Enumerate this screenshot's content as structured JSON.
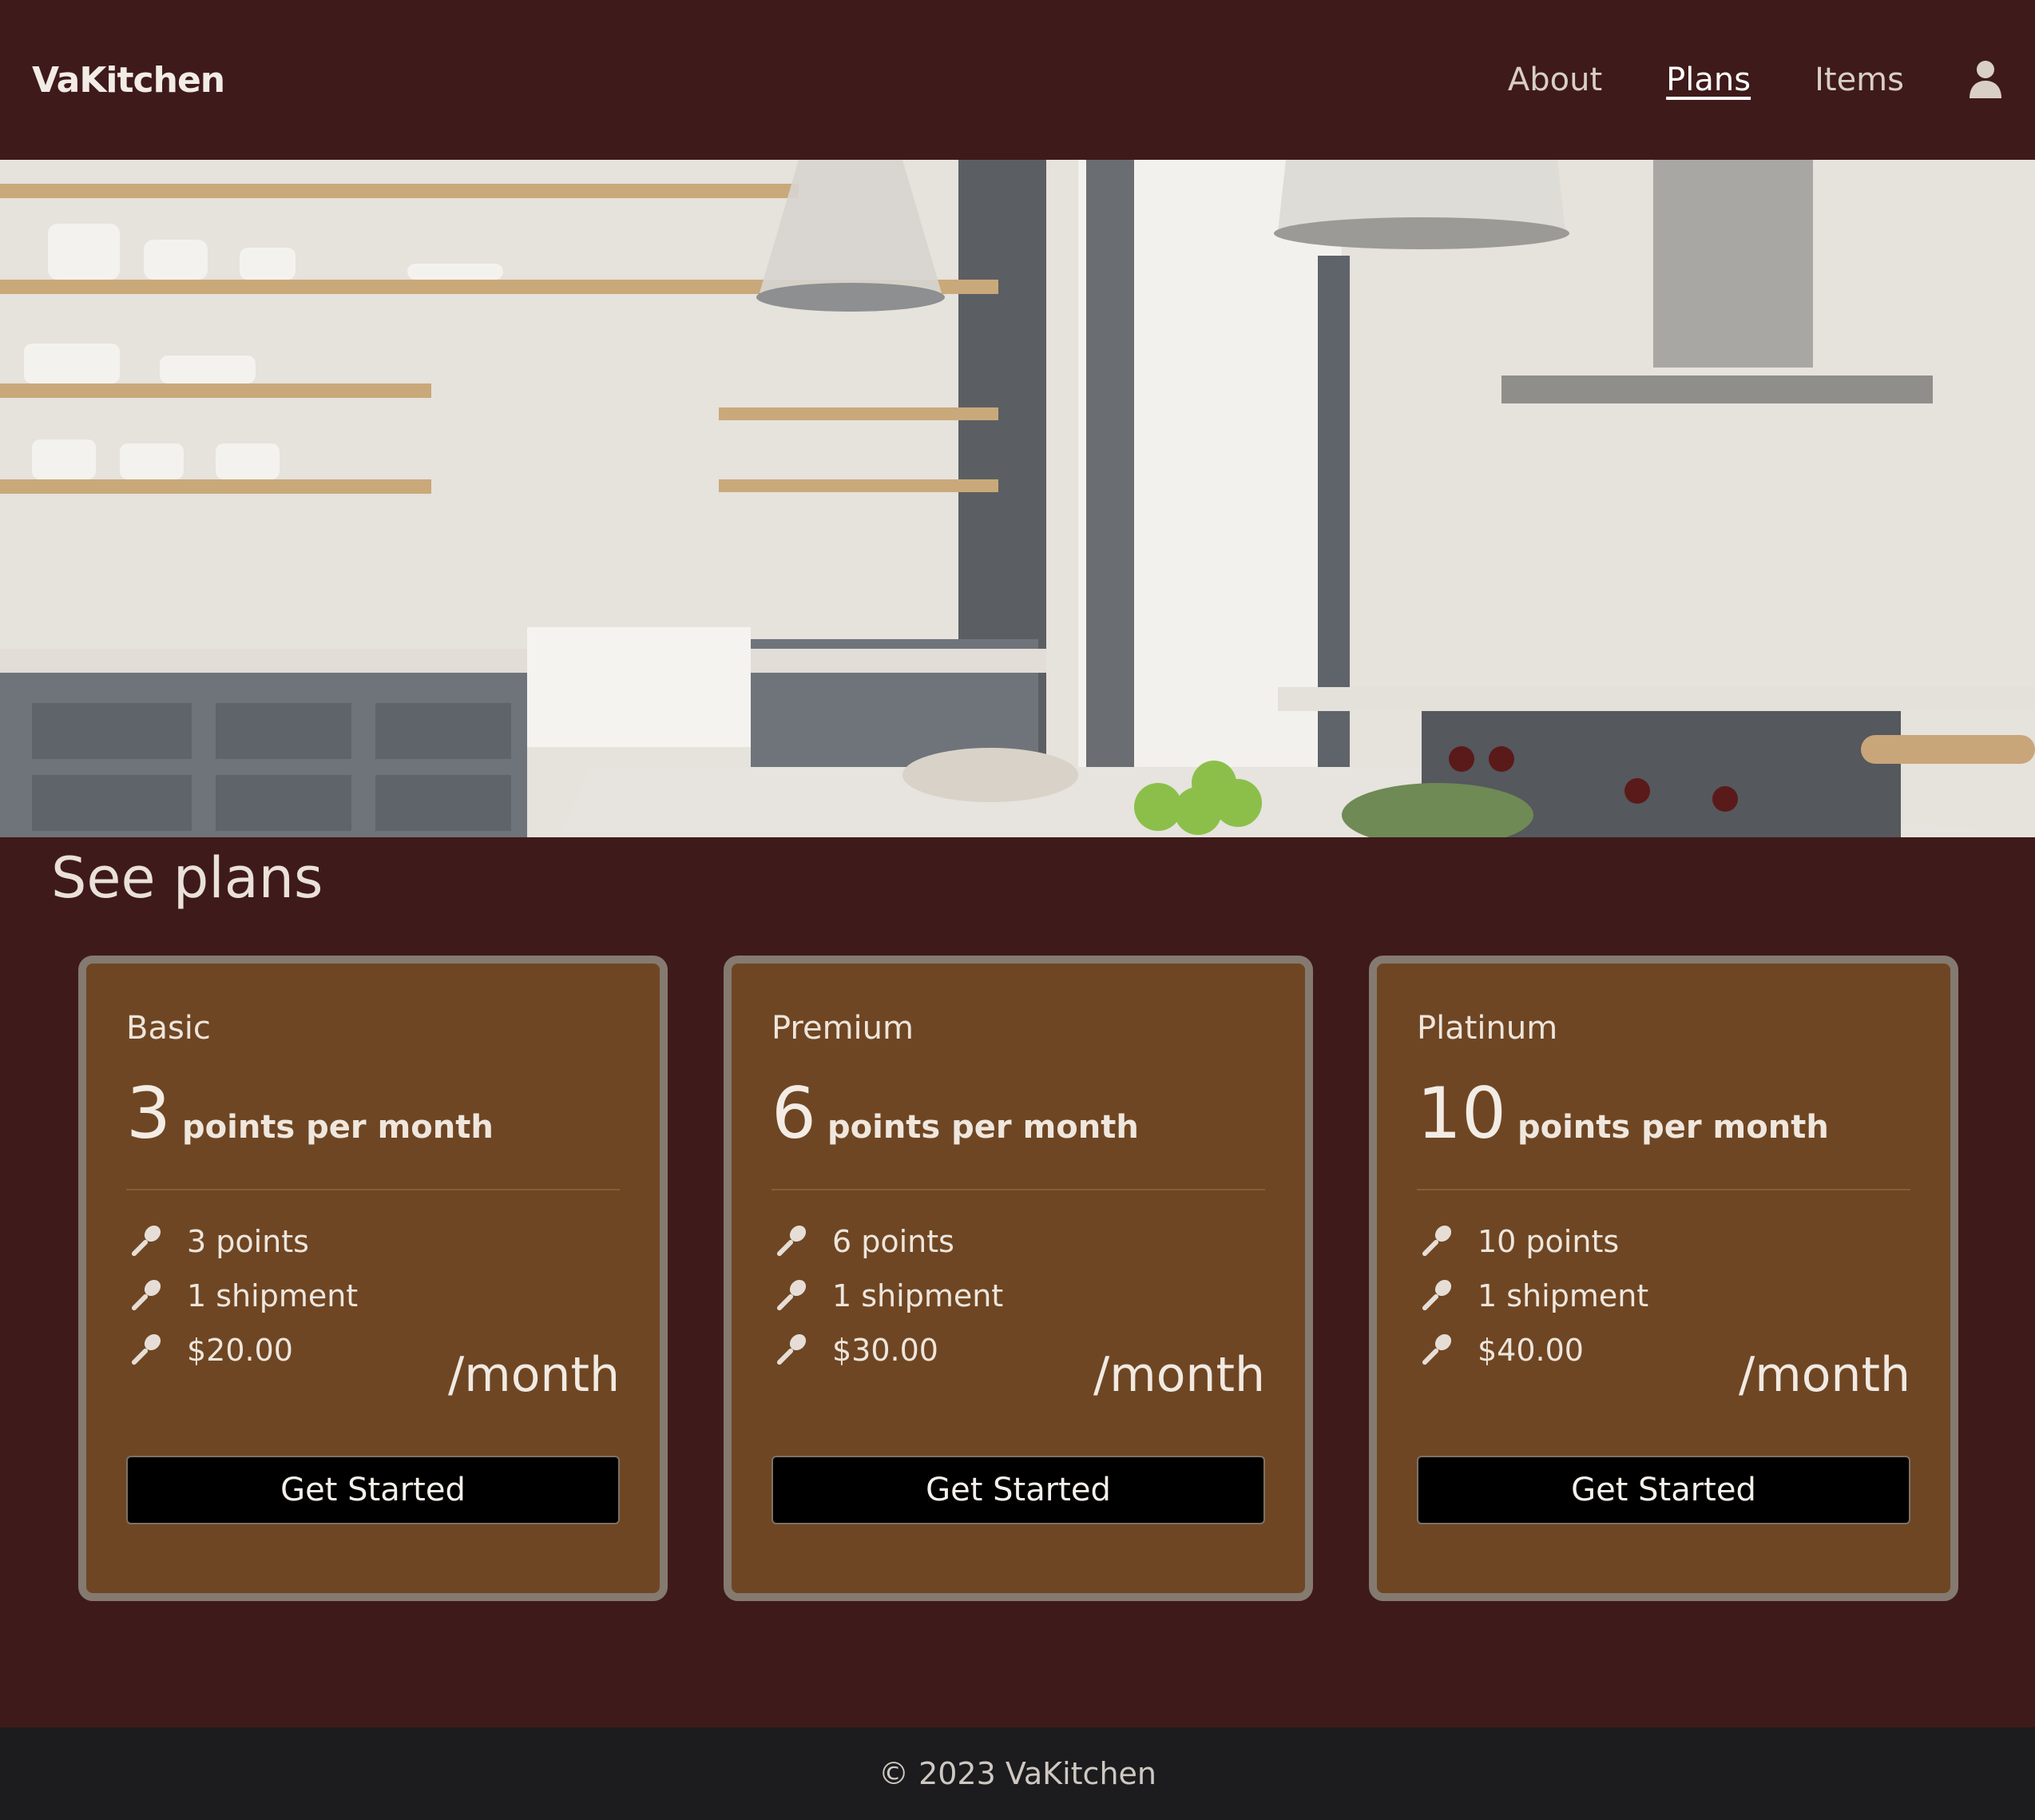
{
  "nav": {
    "brand": "VaKitchen",
    "links": [
      {
        "label": "About"
      },
      {
        "label": "Plans"
      },
      {
        "label": "Items"
      }
    ],
    "user_icon": "user-icon"
  },
  "hero": {
    "image": "kitchen-photo"
  },
  "section": {
    "title": "See plans"
  },
  "plans": [
    {
      "name": "Basic",
      "points": "3",
      "points_unit": "points per month",
      "features": [
        "3 points",
        "1 shipment",
        "$20.00"
      ],
      "per_month": "/month",
      "cta": "Get Started"
    },
    {
      "name": "Premium",
      "points": "6",
      "points_unit": "points per month",
      "features": [
        "6 points",
        "1 shipment",
        "$30.00"
      ],
      "per_month": "/month",
      "cta": "Get Started"
    },
    {
      "name": "Platinum",
      "points": "10",
      "points_unit": "points per month",
      "features": [
        "10 points",
        "1 shipment",
        "$40.00"
      ],
      "per_month": "/month",
      "cta": "Get Started"
    }
  ],
  "footer": {
    "text": "© 2023 VaKitchen"
  },
  "colors": {
    "background": "#3f1a1a",
    "card": "#6f4623",
    "card_border": "#847a70",
    "button": "#000000",
    "footer": "#1c1c1e"
  }
}
